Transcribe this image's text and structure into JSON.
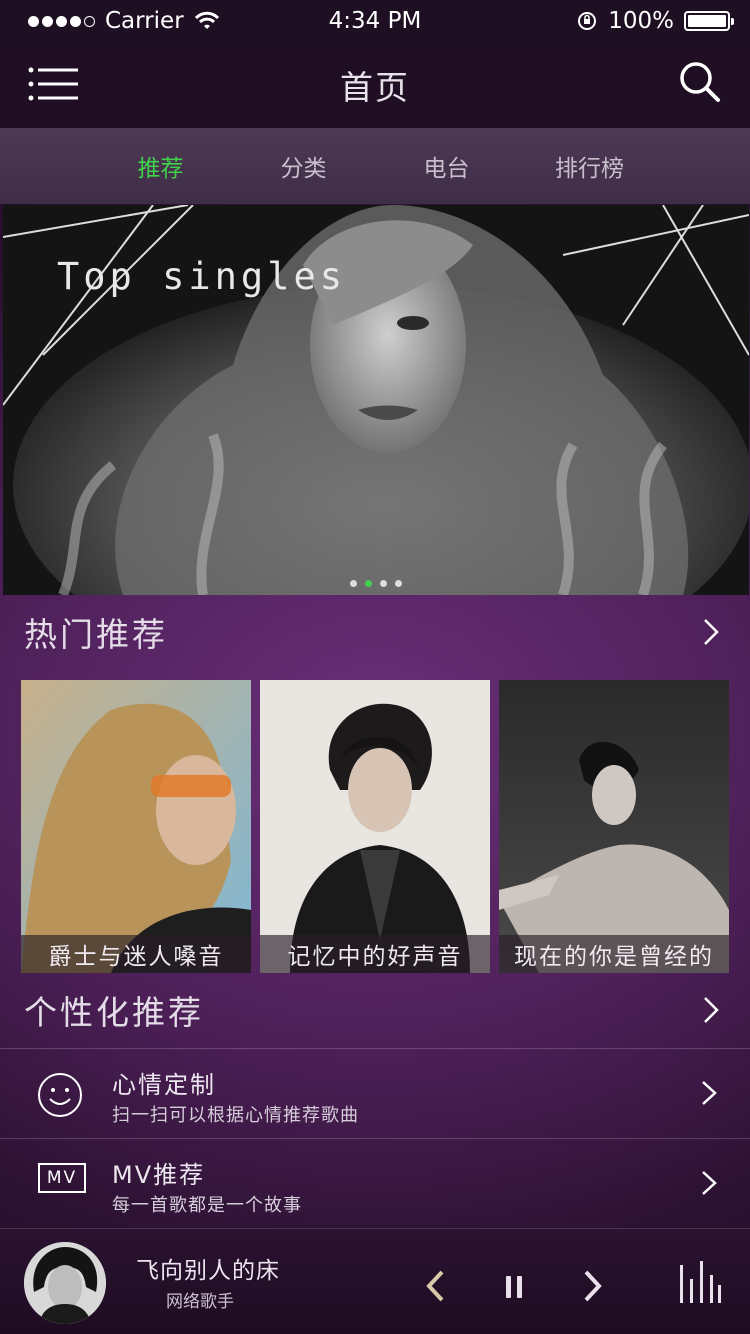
{
  "status": {
    "carrier": "Carrier",
    "time": "4:34 PM",
    "battery": "100%"
  },
  "nav": {
    "title": "首页"
  },
  "tabs": [
    {
      "label": "推荐",
      "active": true
    },
    {
      "label": "分类",
      "active": false
    },
    {
      "label": "电台",
      "active": false
    },
    {
      "label": "排行榜",
      "active": false
    }
  ],
  "banner": {
    "title": "Top singles",
    "page_count": 4,
    "active_page": 1
  },
  "hot": {
    "title": "热门推荐",
    "items": [
      {
        "caption": "爵士与迷人嗓音"
      },
      {
        "caption": "记忆中的好声音"
      },
      {
        "caption": "现在的你是曾经的"
      }
    ]
  },
  "personal": {
    "title": "个性化推荐",
    "items": [
      {
        "icon": "smile-icon",
        "title": "心情定制",
        "subtitle": "扫一扫可以根据心情推荐歌曲"
      },
      {
        "icon": "mv-icon",
        "icon_text": "MV",
        "title": "MV推荐",
        "subtitle": "每一首歌都是一个故事"
      }
    ]
  },
  "player": {
    "song": "飞向别人的床",
    "artist": "网络歌手"
  },
  "colors": {
    "accent": "#3fd24a",
    "background": "#4d2058"
  }
}
